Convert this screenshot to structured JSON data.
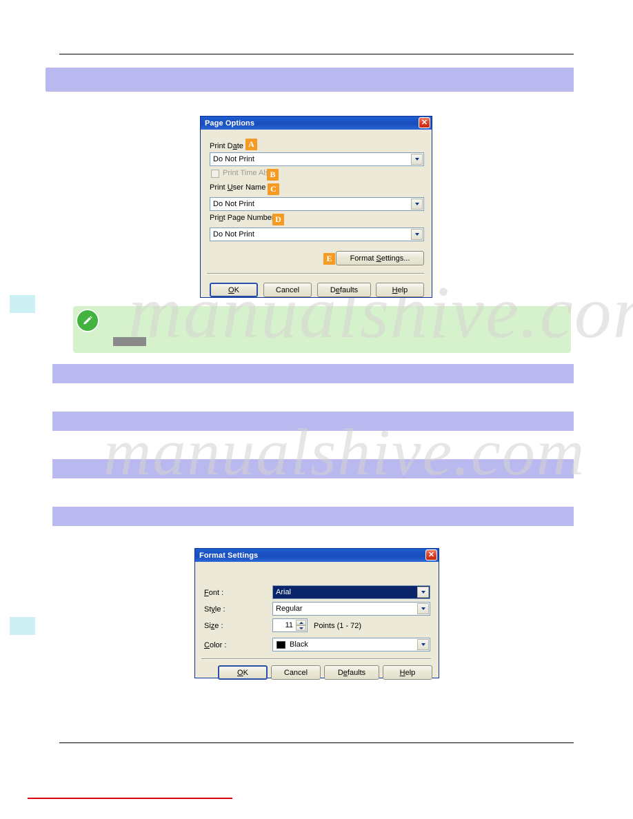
{
  "watermark": {
    "line1": "manualshive.com",
    "line2": "manualshive.com"
  },
  "note": {
    "redacted_label": ""
  },
  "page_options_dialog": {
    "title": "Page Options",
    "close_icon": "close-icon",
    "fields": {
      "print_date_label": "Print Date :",
      "print_date_value": "Do Not Print",
      "print_time_also_label": "Print Time Also",
      "print_user_name_label": "Print User Name :",
      "print_user_name_value": "Do Not Print",
      "print_page_number_label": "Print Page Number :",
      "print_page_number_value": "Do Not Print"
    },
    "buttons": {
      "format_settings": "Format Settings...",
      "ok": "OK",
      "cancel": "Cancel",
      "defaults": "Defaults",
      "help": "Help"
    },
    "callouts": {
      "a": "A",
      "b": "B",
      "c": "C",
      "d": "D",
      "e": "E"
    }
  },
  "format_settings_dialog": {
    "title": "Format Settings",
    "close_icon": "close-icon",
    "fields": {
      "font_label": "Font :",
      "font_value": "Arial",
      "style_label": "Style :",
      "style_value": "Regular",
      "size_label": "Size :",
      "size_value": "11",
      "size_hint": "Points (1 - 72)",
      "color_label": "Color :",
      "color_value": "Black",
      "color_swatch": "#000000"
    },
    "buttons": {
      "ok": "OK",
      "cancel": "Cancel",
      "defaults": "Defaults",
      "help": "Help"
    }
  }
}
